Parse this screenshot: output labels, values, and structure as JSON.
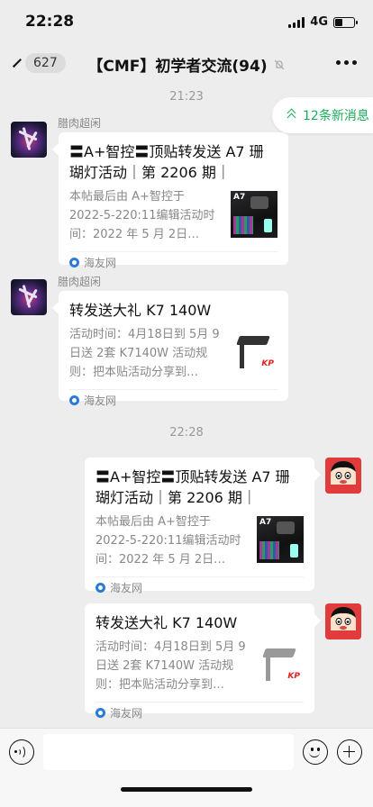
{
  "status": {
    "time": "22:28",
    "network": "4G",
    "battery_percent": 40
  },
  "nav": {
    "unread_count": "627",
    "title": "【CMF】初学者交流(94)"
  },
  "new_messages": "12条新消息",
  "separators": [
    "21:23",
    "22:28"
  ],
  "messages": [
    {
      "side": "left",
      "sender": "腊肉超闲",
      "title": "〓A+智控〓顶贴转发送 A7 珊瑚灯活动｜第 2206 期｜",
      "desc": "本帖最后由 A+智控于 2022-5-220:11编辑活动时间：2022 年 5 月 2日…",
      "thumb_label": "A7",
      "source": "海友网"
    },
    {
      "side": "left",
      "sender": "腊肉超闲",
      "title": "转发送大礼 K7 140W",
      "desc": "活动时间：4月18日到 5月 9日送 2套 K7140W 活动规则：把本贴活动分享到…",
      "thumb_label": "KP",
      "source": "海友网"
    },
    {
      "side": "right",
      "title": "〓A+智控〓顶贴转发送 A7 珊瑚灯活动｜第 2206 期｜",
      "desc": "本帖最后由 A+智控于 2022-5-220:11编辑活动时间：2022 年 5 月 2日…",
      "thumb_label": "A7",
      "source": "海友网"
    },
    {
      "side": "right",
      "title": "转发送大礼 K7 140W",
      "desc": "活动时间：4月18日到 5月 9日送 2套 K7140W 活动规则：把本贴活动分享到…",
      "thumb_label": "KP",
      "source": "海友网"
    }
  ],
  "icons": {
    "back": "chevron-left-icon",
    "mute": "bell-off-icon",
    "more": "more-dots-icon",
    "voice": "voice-icon",
    "emoji": "emoji-icon",
    "add": "plus-icon",
    "source": "haiyou-logo-icon"
  },
  "colors": {
    "accent": "#1aad5a",
    "background": "#ededed"
  }
}
